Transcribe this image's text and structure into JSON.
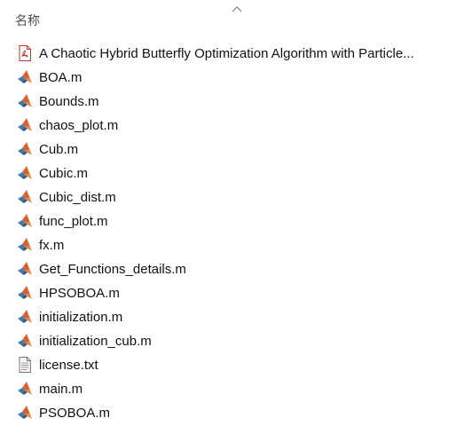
{
  "header": {
    "name_column_label": "名称",
    "sort_indicator_icon": "chevron-up-icon"
  },
  "files": [
    {
      "name": "A Chaotic Hybrid Butterfly Optimization Algorithm with Particle...",
      "icon": "pdf-file-icon"
    },
    {
      "name": "BOA.m",
      "icon": "matlab-file-icon"
    },
    {
      "name": "Bounds.m",
      "icon": "matlab-file-icon"
    },
    {
      "name": "chaos_plot.m",
      "icon": "matlab-file-icon"
    },
    {
      "name": "Cub.m",
      "icon": "matlab-file-icon"
    },
    {
      "name": "Cubic.m",
      "icon": "matlab-file-icon"
    },
    {
      "name": "Cubic_dist.m",
      "icon": "matlab-file-icon"
    },
    {
      "name": "func_plot.m",
      "icon": "matlab-file-icon"
    },
    {
      "name": "fx.m",
      "icon": "matlab-file-icon"
    },
    {
      "name": "Get_Functions_details.m",
      "icon": "matlab-file-icon"
    },
    {
      "name": "HPSOBOA.m",
      "icon": "matlab-file-icon"
    },
    {
      "name": "initialization.m",
      "icon": "matlab-file-icon"
    },
    {
      "name": "initialization_cub.m",
      "icon": "matlab-file-icon"
    },
    {
      "name": "license.txt",
      "icon": "text-file-icon"
    },
    {
      "name": "main.m",
      "icon": "matlab-file-icon"
    },
    {
      "name": "PSOBOA.m",
      "icon": "matlab-file-icon"
    }
  ]
}
